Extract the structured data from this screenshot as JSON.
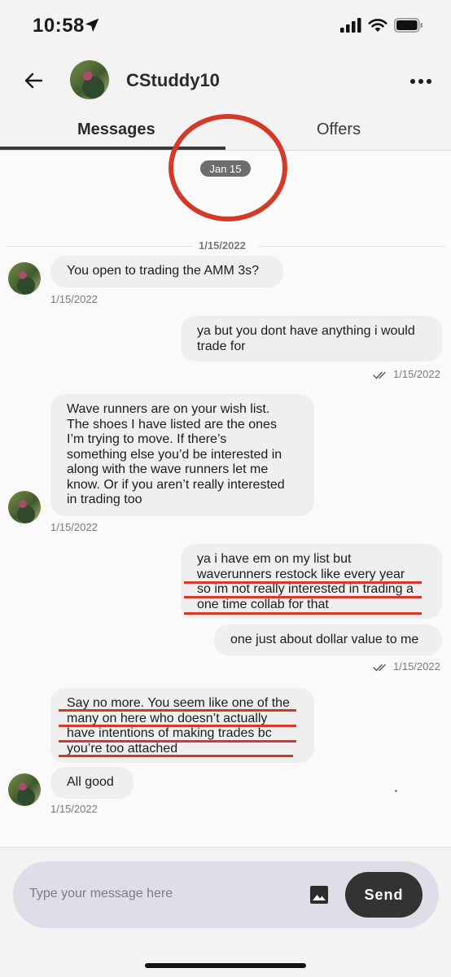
{
  "status_bar": {
    "time": "10:58"
  },
  "header": {
    "username": "CStuddy10",
    "tabs": [
      {
        "label": "Messages",
        "active": true
      },
      {
        "label": "Offers",
        "active": false
      }
    ]
  },
  "date_pill": "Jan 15",
  "date_separator": "1/15/2022",
  "messages": [
    {
      "direction": "in",
      "text": "You open to trading the AMM 3s?",
      "time": "1/15/2022"
    },
    {
      "direction": "out",
      "text": "ya but you dont have anything i would\ntrade for",
      "time": "1/15/2022"
    },
    {
      "direction": "in",
      "text": "Wave runners are on your wish list.\nThe shoes I have listed are the ones\nI’m trying to move. If there’s\nsomething else you’d be interested in\nalong with the wave runners let me\nknow. Or if you aren’t really interested\nin trading too",
      "time": "1/15/2022"
    },
    {
      "direction": "out",
      "text": "ya i have em on my list but\nwaverunners restock like every year\nso im not really interested in trading a\none time collab for that"
    },
    {
      "direction": "out",
      "text": "one just about dollar value to me",
      "time": "1/15/2022"
    },
    {
      "direction": "in",
      "text": "Say no more. You seem like one of the\nmany on here who doesn’t actually\nhave intentions of making trades bc\nyou’re too attached"
    },
    {
      "direction": "in",
      "text": "All good",
      "time": "1/15/2022"
    }
  ],
  "composer": {
    "placeholder": "Type your message here",
    "send_label": "Send"
  },
  "colors": {
    "annotation_red": "#d33a27",
    "bubble": "#efefef",
    "send_button": "#333333"
  }
}
